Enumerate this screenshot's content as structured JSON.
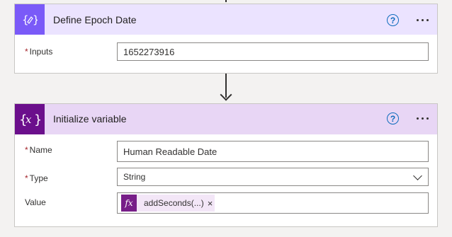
{
  "card1": {
    "title": "Define Epoch Date",
    "icon": "compose-icon",
    "help": "?",
    "fields": {
      "inputs_label": "Inputs",
      "inputs_value": "1652273916",
      "required_mark": "*"
    }
  },
  "card2": {
    "title": "Initialize variable",
    "icon": "variable-icon",
    "help": "?",
    "fields": {
      "required_mark": "*",
      "name_label": "Name",
      "name_value": "Human Readable Date",
      "type_label": "Type",
      "type_value": "String",
      "value_label": "Value",
      "token_label": "addSeconds(...)",
      "token_icon_text": "fx",
      "token_close": "×"
    }
  },
  "colors": {
    "compose_accent": "#7a5af8",
    "variable_accent": "#6b0f8c",
    "expression_token": "#771e88",
    "required": "#a4262c",
    "link": "#0f6cbd"
  }
}
